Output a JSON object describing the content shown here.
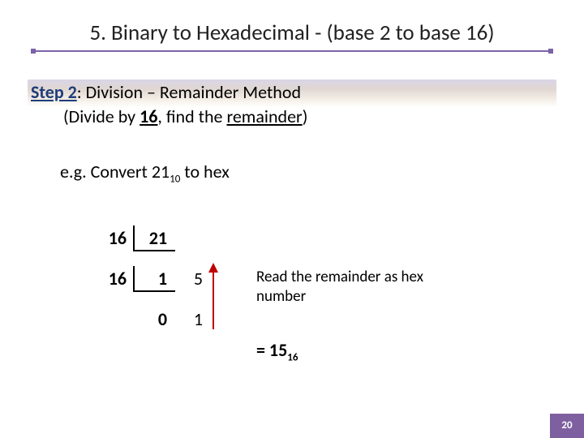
{
  "title": "5. Binary to Hexadecimal - (base 2 to base 16)",
  "step": {
    "label": "Step 2",
    "text": ": Division – Remainder Method",
    "sub_pre": "(Divide by ",
    "sub_divisor": "16",
    "sub_mid": ", find the ",
    "sub_rem": "remainder",
    "sub_post": ")"
  },
  "example": {
    "pre": "e.g. Convert 21",
    "sub": "10",
    "post": " to hex"
  },
  "calc": {
    "div1": "16",
    "n1": "21",
    "div2": "16",
    "q1": "1",
    "r1": "5",
    "q2": "0",
    "r2": "1"
  },
  "note": "Read the remainder as hex number",
  "result": {
    "pre": "= 15",
    "sub": "16"
  },
  "page": "20"
}
